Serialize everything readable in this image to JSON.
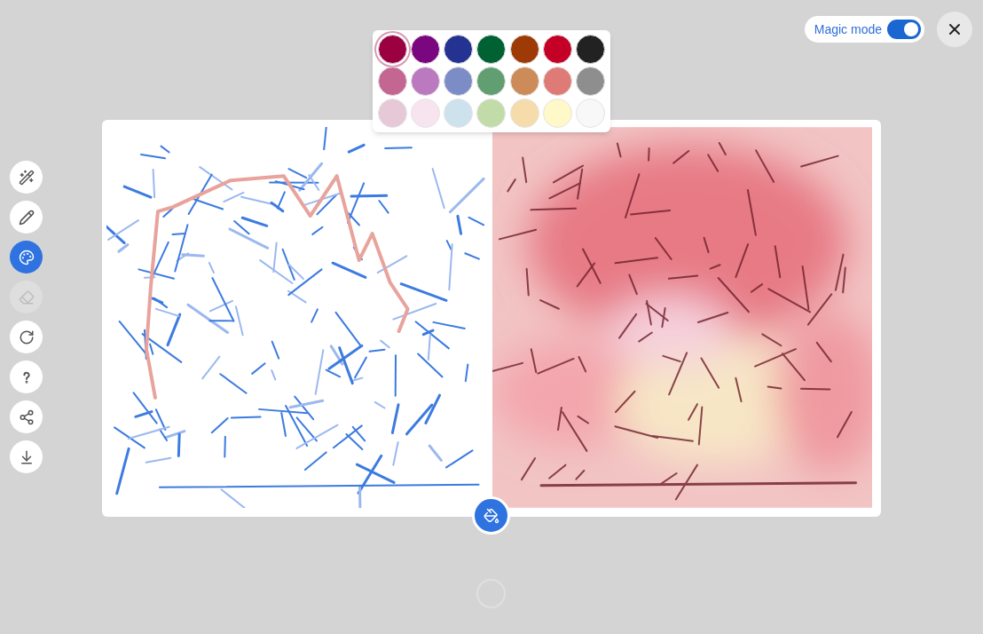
{
  "toggle": {
    "label": "Magic mode",
    "on": true
  },
  "tools": [
    {
      "kind": "magic",
      "selected": false,
      "disabled": false
    },
    {
      "kind": "pencil",
      "selected": false,
      "disabled": false
    },
    {
      "kind": "palette",
      "selected": true,
      "disabled": false
    },
    {
      "kind": "eraser",
      "selected": false,
      "disabled": true
    },
    {
      "kind": "redo",
      "selected": false,
      "disabled": false
    },
    {
      "kind": "help",
      "selected": false,
      "disabled": false
    },
    {
      "kind": "share",
      "selected": false,
      "disabled": false
    },
    {
      "kind": "download",
      "selected": false,
      "disabled": false
    }
  ],
  "palette": [
    {
      "color": "#9b0041",
      "selected": true
    },
    {
      "color": "#7a0680",
      "selected": false
    },
    {
      "color": "#243392",
      "selected": false
    },
    {
      "color": "#006133",
      "selected": false
    },
    {
      "color": "#9e3a06",
      "selected": false
    },
    {
      "color": "#c50026",
      "selected": false
    },
    {
      "color": "#222222",
      "selected": false
    },
    {
      "color": "#c36792",
      "selected": false
    },
    {
      "color": "#bb79bf",
      "selected": false
    },
    {
      "color": "#7b8cc7",
      "selected": false
    },
    {
      "color": "#619f72",
      "selected": false
    },
    {
      "color": "#cc8b59",
      "selected": false
    },
    {
      "color": "#df7b76",
      "selected": false
    },
    {
      "color": "#8e8e8e",
      "selected": false
    },
    {
      "color": "#e6c8d7",
      "selected": false
    },
    {
      "color": "#f8e4ef",
      "selected": false
    },
    {
      "color": "#cde2ed",
      "selected": false
    },
    {
      "color": "#c1dba9",
      "selected": false
    },
    {
      "color": "#f6dcab",
      "selected": false
    },
    {
      "color": "#fff8c8",
      "selected": false
    },
    {
      "color": "#f8f8f8",
      "selected": false
    }
  ]
}
